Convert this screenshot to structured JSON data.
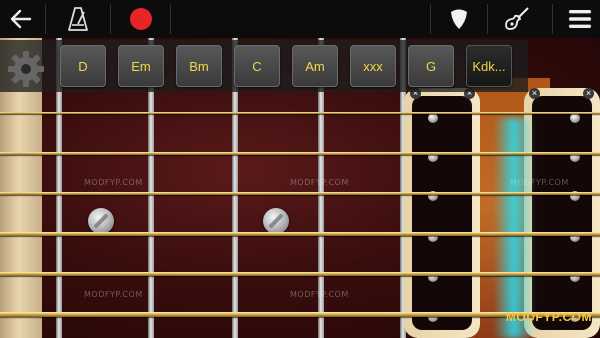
{
  "toolbar": {
    "back_icon": "arrow-left-icon",
    "metronome_icon": "metronome-icon",
    "record_icon": "record-icon",
    "record_color": "#e82424",
    "pick_icon": "guitar-pick-icon",
    "guitar_icon": "guitar-icon",
    "menu_icon": "hamburger-menu-icon"
  },
  "chords": {
    "settings_icon": "gear-icon",
    "items": [
      {
        "label": "D"
      },
      {
        "label": "Em"
      },
      {
        "label": "Bm"
      },
      {
        "label": "C"
      },
      {
        "label": "Am"
      },
      {
        "label": "xxx"
      },
      {
        "label": "G"
      },
      {
        "label": "Kdk..."
      }
    ],
    "label_color": "#f0d84a"
  },
  "watermark": {
    "text": "MODFYP.COM",
    "brand": "MODFYP.COM"
  }
}
